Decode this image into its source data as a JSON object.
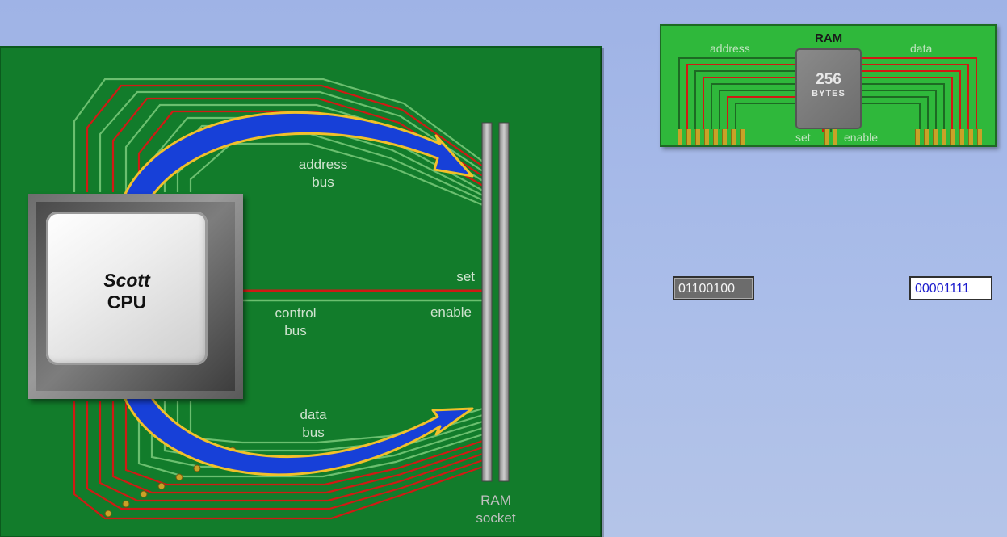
{
  "cpu": {
    "name": "Scott",
    "label": "CPU"
  },
  "buses": {
    "address": "address\nbus",
    "control": "control\nbus",
    "data": "data\nbus"
  },
  "signals": {
    "set": "set",
    "enable": "enable"
  },
  "socket": {
    "label": "RAM\nsocket"
  },
  "ram": {
    "title": "RAM",
    "size_number": "256",
    "size_unit": "BYTES",
    "address_label": "address",
    "data_label": "data",
    "set_label": "set",
    "enable_label": "enable"
  },
  "registers": {
    "address_value": "01100100",
    "data_value": "00001111"
  },
  "colors": {
    "board": "#127c2b",
    "wire_red": "#d01a14",
    "wire_green": "#6bbf6f",
    "arrow_blue": "#1740d8",
    "arrow_outline": "#f1c02a"
  }
}
